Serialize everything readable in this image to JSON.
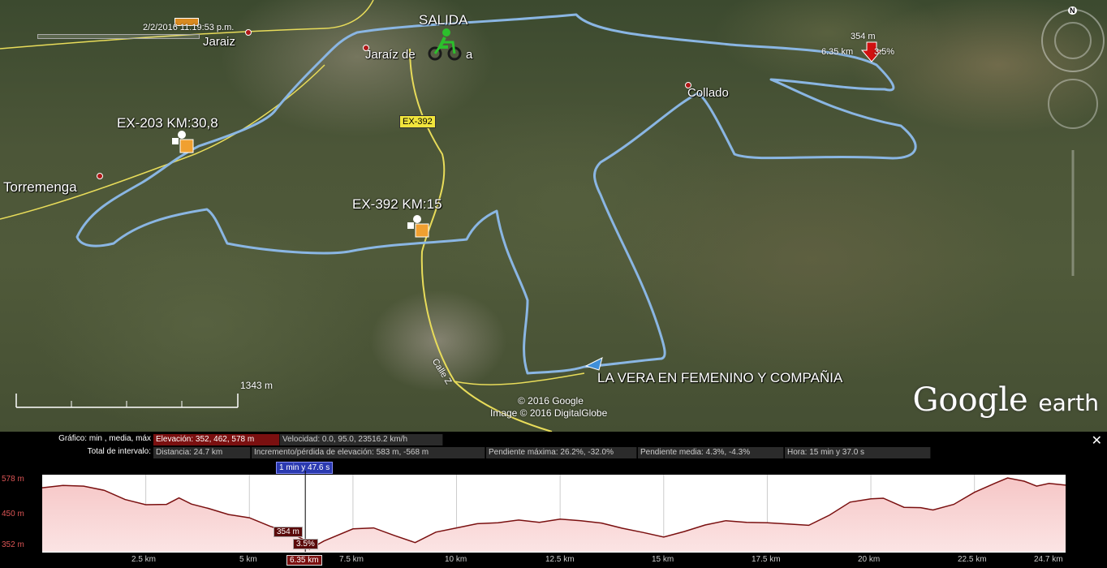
{
  "map": {
    "timestamp": "2/2/2016  11:19:53 p.m.",
    "start_label": "SALIDA",
    "towns": [
      {
        "name": "Jaraiz",
        "key": "jaraiz"
      },
      {
        "name": "Jaraíz de la Vera",
        "key": "jaraiz-vera"
      },
      {
        "name": "Collado",
        "key": "collado"
      },
      {
        "name": "Torremenga",
        "key": "torremenga"
      }
    ],
    "jaraiz_vera_visible_left": "Jaraíz de",
    "jaraiz_vera_visible_right": "a",
    "road_sign": "EX-392",
    "checkpoints": [
      {
        "label": "EX-203  KM:30,8"
      },
      {
        "label": "EX-392   KM:15"
      }
    ],
    "street": "Calle Z",
    "route_title": "LA VERA EN FEMENINO Y COMPAÑIA",
    "cursor_marker": {
      "elevation": "354 m",
      "distance": "6.35 km",
      "grade": "3.5%"
    },
    "scale_label": "1343 m",
    "copyright": "© 2016 Google",
    "imagery": "Image © 2016 DigitalGlobe",
    "logo": {
      "google": "Google",
      "earth": "earth"
    },
    "compass_n": "N",
    "colors": {
      "track": "#8ab6e3",
      "road": "#e8dc5a",
      "marker": "#d01010"
    }
  },
  "profile": {
    "graph_label": "Gráfico:",
    "graph_modes": "min , media, máx",
    "elevation": "Elevación: 352, 462, 578 m",
    "speed": "Velocidad: 0.0, 95.0, 23516.2 km/h",
    "interval_label": "Total de intervalo:",
    "distance": "Distancia: 24.7 km",
    "gain_loss": "Incremento/pérdida de elevación: 583 m, -568 m",
    "max_slope": "Pendiente máxima: 26.2%, -32.0%",
    "avg_slope": "Pendiente media: 4.3%, -4.3%",
    "time": "Hora: 15 min y 37.0 s",
    "cursor_time": "1 min y 47.6 s",
    "cursor_elev": "354 m",
    "cursor_grade": "3.5%",
    "cursor_dist": "6.35 km",
    "close": "✕",
    "y_ticks": [
      "578 m",
      "450 m",
      "352 m"
    ],
    "x_ticks": [
      "2.5 km",
      "5 km",
      "7.5 km",
      "10 km",
      "12.5 km",
      "15 km",
      "17.5 km",
      "20 km",
      "22.5 km",
      "24.7 km"
    ]
  },
  "chart_data": {
    "type": "area",
    "title": "",
    "xlabel": "",
    "ylabel": "",
    "ylim": [
      352,
      578
    ],
    "xlim": [
      0,
      24.7
    ],
    "x_unit": "km",
    "y_unit": "m",
    "grid": true,
    "cursor_x": 6.35,
    "series": [
      {
        "x": [
          0,
          0.5,
          1.0,
          1.5,
          2.0,
          2.5,
          3.0,
          3.3,
          3.6,
          4.0,
          4.5,
          5.0,
          5.5,
          6.0,
          6.3,
          6.45,
          6.8,
          7.5,
          8.0,
          8.5,
          9.0,
          9.5,
          10.0,
          10.5,
          11.0,
          11.5,
          12.0,
          12.5,
          13.0,
          13.5,
          14.0,
          14.5,
          15.0,
          15.5,
          16.0,
          16.5,
          17.0,
          17.5,
          18.0,
          18.5,
          19.0,
          19.5,
          20.0,
          20.3,
          20.8,
          21.2,
          21.5,
          22.0,
          22.5,
          23.0,
          23.3,
          23.7,
          24.0,
          24.3,
          24.7
        ],
        "y": [
          548,
          555,
          553,
          540,
          512,
          496,
          497,
          517,
          498,
          485,
          466,
          456,
          430,
          410,
          390,
          360,
          385,
          422,
          425,
          402,
          380,
          412,
          425,
          438,
          441,
          449,
          442,
          452,
          447,
          440,
          424,
          411,
          397,
          414,
          434,
          447,
          442,
          441,
          437,
          433,
          464,
          504,
          514,
          516,
          488,
          487,
          480,
          497,
          534,
          562,
          578,
          568,
          553,
          561,
          556
        ]
      }
    ]
  }
}
